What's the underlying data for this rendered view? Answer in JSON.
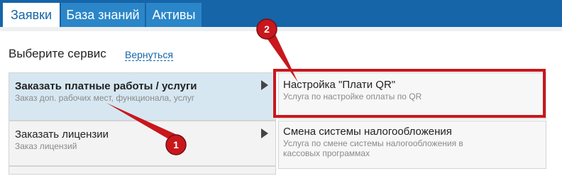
{
  "tabs": [
    {
      "label": "Заявки"
    },
    {
      "label": "База знаний"
    },
    {
      "label": "Активы"
    }
  ],
  "page": {
    "heading": "Выберите сервис",
    "back_link": "Вернуться"
  },
  "categories": [
    {
      "title": "Заказать платные работы / услуги",
      "subtitle": "Заказ доп. рабочих мест, функционала, услуг"
    },
    {
      "title": "Заказать лицензии",
      "subtitle": "Заказ лицензий"
    }
  ],
  "services": [
    {
      "title": "Настройка \"Плати QR\"",
      "subtitle": "Услуга по настройке оплаты по QR"
    },
    {
      "title": "Смена системы налогообложения",
      "subtitle": "Услуга по смене системы налогообложения в кассовых программах"
    }
  ],
  "annotations": {
    "badge_1": "1",
    "badge_2": "2",
    "color": "#c8171d"
  },
  "colors": {
    "topbar": "#1565a8",
    "selected_category": "#d6e7f1"
  }
}
